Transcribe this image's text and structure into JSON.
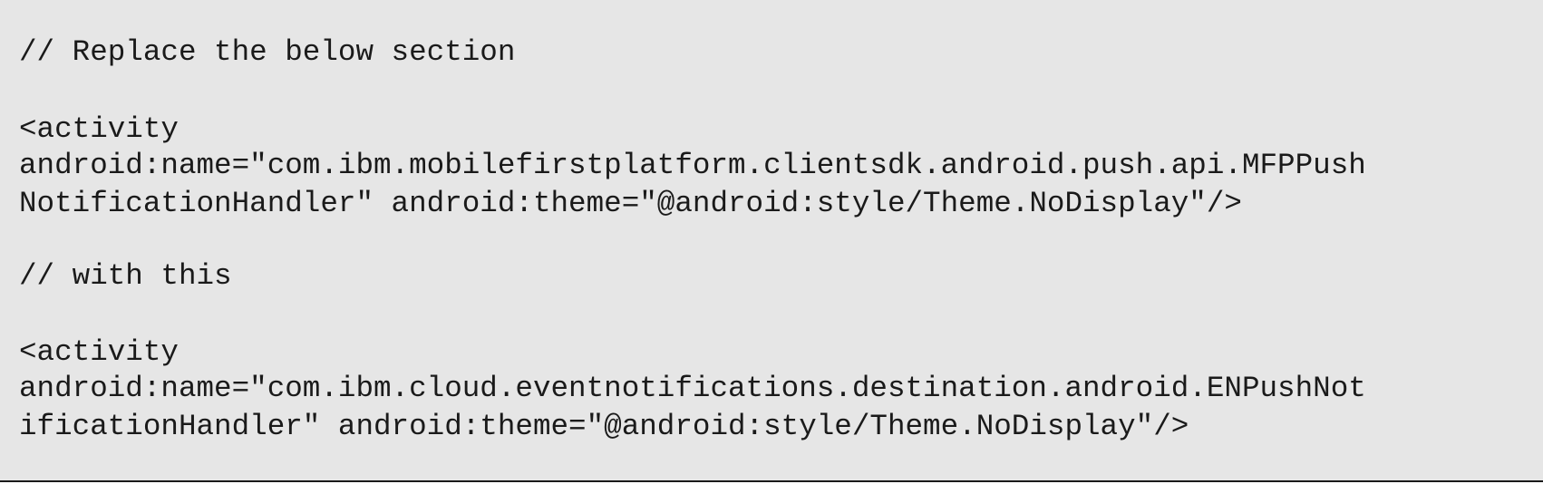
{
  "code_snippet": {
    "lines": [
      "// Replace the below section",
      "<activity",
      "android:name=\"com.ibm.mobilefirstplatform.clientsdk.android.push.api.MFPPush",
      "NotificationHandler\" android:theme=\"@android:style/Theme.NoDisplay\"/>",
      "// with this",
      "<activity",
      "android:name=\"com.ibm.cloud.eventnotifications.destination.android.ENPushNot",
      "ificationHandler\" android:theme=\"@android:style/Theme.NoDisplay\"/>"
    ]
  }
}
